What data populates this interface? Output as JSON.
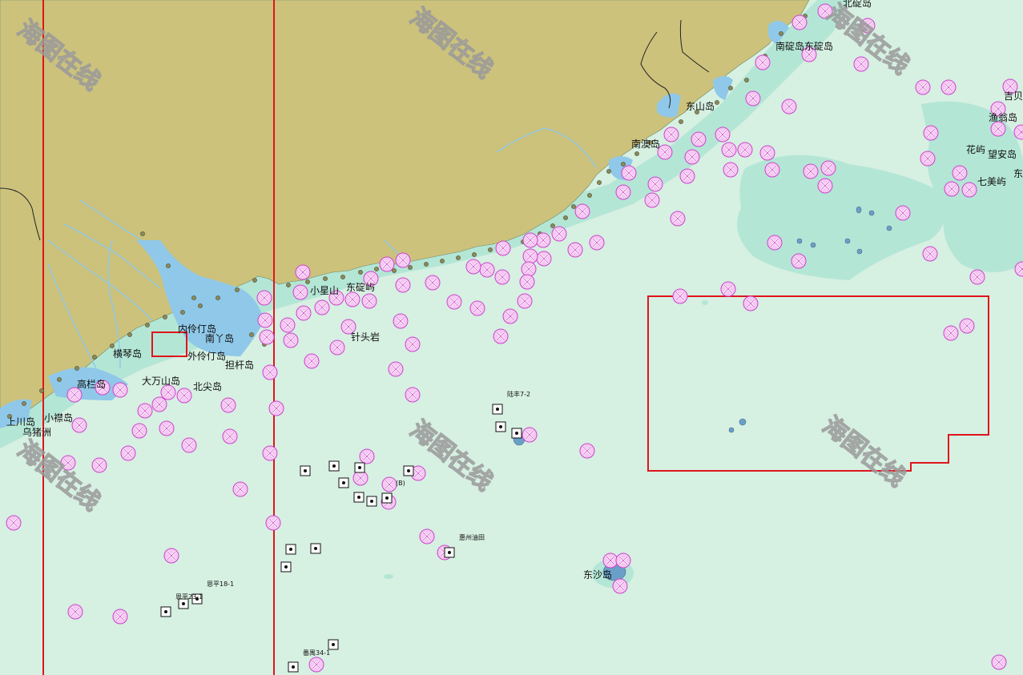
{
  "watermark": {
    "text": "海图在线"
  },
  "colors": {
    "sea": "#d6f0e2",
    "shallow": "#b4e6d6",
    "land": "#ccc27c",
    "inner_water": "#8fc8e8",
    "wreck": "#cc44cc",
    "boundary": "#e0141c"
  },
  "symbols": {
    "wreck": "wreck-x-symbol",
    "platform": "oil-platform-symbol"
  },
  "labels": {
    "beiding": "北碇岛",
    "nanding_dongding": "南碇岛东碇岛",
    "jibei": "吉贝",
    "yuwong": "渔翁岛",
    "huayu": "花屿",
    "wangan": "望安岛",
    "dong": "东",
    "qimei": "七美屿",
    "dongshan": "东山岛",
    "nanao": "南澳岛",
    "xiaoxingshan": "小星山",
    "dongdingyu": "东碇屿",
    "zhentouyan": "针头岩",
    "neilingding": "内伶仃岛",
    "nanya": "南丫岛",
    "wailingding": "外伶仃岛",
    "dangan": "担杆岛",
    "hengqin": "横琴岛",
    "dawanshan": "大万山岛",
    "beijian": "北尖岛",
    "gaolan": "高栏岛",
    "shangchuan": "上川岛",
    "xiaojin": "小襟岛",
    "wuzhuzhou": "乌猪洲",
    "lufeng": "陆丰7-2",
    "huizhou": "惠州油田",
    "enping": "恩平18-1",
    "enping2": "恩平23-1",
    "panyu": "番禺34-1",
    "dongsha": "东沙岛",
    "b_mark": "(B)"
  }
}
